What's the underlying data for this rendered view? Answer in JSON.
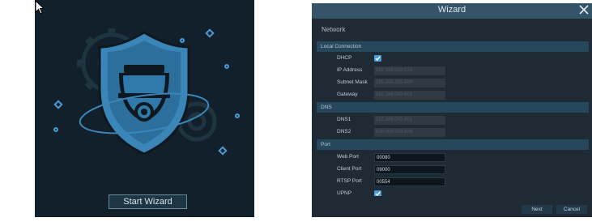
{
  "left": {
    "start_button": "Start Wizard"
  },
  "wizard": {
    "title": "Wizard",
    "section": "Network",
    "groups": {
      "local": "Local Connection",
      "dns": "DNS",
      "port": "Port"
    },
    "fields": {
      "dhcp": {
        "label": "DHCP"
      },
      "ip": {
        "label": "IP Address",
        "value": "192.168.000.024"
      },
      "subnet": {
        "label": "Subnet Mask",
        "value": "255.255.255.000"
      },
      "gateway": {
        "label": "Gateway",
        "value": "192.168.000.001"
      },
      "dns1": {
        "label": "DNS1",
        "value": "192.168.000.001"
      },
      "dns2": {
        "label": "DNS2",
        "value": "008.008.008.008"
      },
      "web_port": {
        "label": "Web Port",
        "value": "00080"
      },
      "client_port": {
        "label": "Client Port",
        "value": "09000"
      },
      "rtsp_port": {
        "label": "RTSP Port",
        "value": "00554"
      },
      "upnp": {
        "label": "UPNP"
      }
    },
    "buttons": {
      "next": "Next",
      "cancel": "Cancel"
    }
  },
  "colors": {
    "accent": "#4a9bd6",
    "titlebar": "#355468",
    "panel": "#1e2b34"
  }
}
